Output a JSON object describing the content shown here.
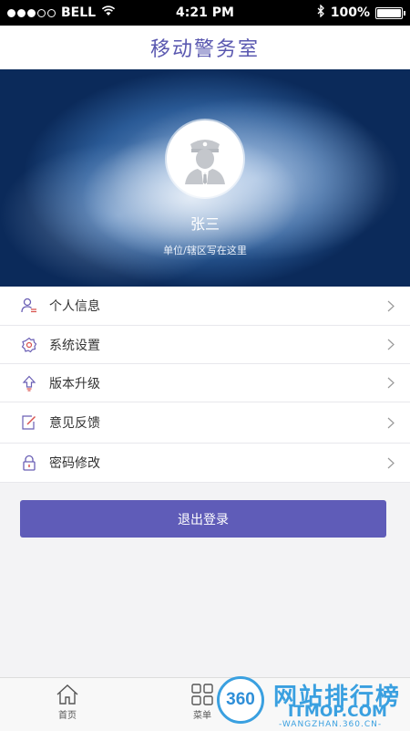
{
  "status_bar": {
    "carrier": "BELL",
    "time": "4:21 PM",
    "battery_percent": "100%",
    "battery_level": 1.0
  },
  "header": {
    "title": "移动警务室"
  },
  "profile": {
    "name": "张三",
    "unit": "单位/辖区写在这里"
  },
  "menu": [
    {
      "label": "个人信息",
      "icon": "person-info-icon"
    },
    {
      "label": "系统设置",
      "icon": "settings-gear-icon"
    },
    {
      "label": "版本升级",
      "icon": "upgrade-arrow-icon"
    },
    {
      "label": "意见反馈",
      "icon": "feedback-edit-icon"
    },
    {
      "label": "密码修改",
      "icon": "lock-icon"
    }
  ],
  "logout_label": "退出登录",
  "bottom_nav": {
    "home_label": "首页",
    "menu_label": "菜单"
  },
  "watermark": {
    "badge": "360",
    "big": "网站排行榜",
    "small": "ITMOP.COM",
    "url": "-WANGZHAN.360.CN-"
  },
  "colors": {
    "accent": "#5f5cb8",
    "title": "#5a58b0",
    "icon_red": "#d9534f",
    "icon_purple": "#6a5fb5"
  }
}
